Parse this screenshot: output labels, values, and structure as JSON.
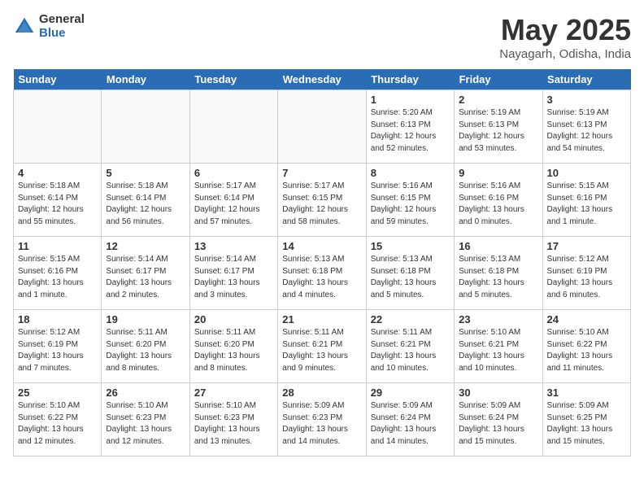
{
  "header": {
    "logo_general": "General",
    "logo_blue": "Blue",
    "month_title": "May 2025",
    "location": "Nayagarh, Odisha, India"
  },
  "days_of_week": [
    "Sunday",
    "Monday",
    "Tuesday",
    "Wednesday",
    "Thursday",
    "Friday",
    "Saturday"
  ],
  "weeks": [
    [
      {
        "day": "",
        "info": ""
      },
      {
        "day": "",
        "info": ""
      },
      {
        "day": "",
        "info": ""
      },
      {
        "day": "",
        "info": ""
      },
      {
        "day": "1",
        "info": "Sunrise: 5:20 AM\nSunset: 6:13 PM\nDaylight: 12 hours\nand 52 minutes."
      },
      {
        "day": "2",
        "info": "Sunrise: 5:19 AM\nSunset: 6:13 PM\nDaylight: 12 hours\nand 53 minutes."
      },
      {
        "day": "3",
        "info": "Sunrise: 5:19 AM\nSunset: 6:13 PM\nDaylight: 12 hours\nand 54 minutes."
      }
    ],
    [
      {
        "day": "4",
        "info": "Sunrise: 5:18 AM\nSunset: 6:14 PM\nDaylight: 12 hours\nand 55 minutes."
      },
      {
        "day": "5",
        "info": "Sunrise: 5:18 AM\nSunset: 6:14 PM\nDaylight: 12 hours\nand 56 minutes."
      },
      {
        "day": "6",
        "info": "Sunrise: 5:17 AM\nSunset: 6:14 PM\nDaylight: 12 hours\nand 57 minutes."
      },
      {
        "day": "7",
        "info": "Sunrise: 5:17 AM\nSunset: 6:15 PM\nDaylight: 12 hours\nand 58 minutes."
      },
      {
        "day": "8",
        "info": "Sunrise: 5:16 AM\nSunset: 6:15 PM\nDaylight: 12 hours\nand 59 minutes."
      },
      {
        "day": "9",
        "info": "Sunrise: 5:16 AM\nSunset: 6:16 PM\nDaylight: 13 hours\nand 0 minutes."
      },
      {
        "day": "10",
        "info": "Sunrise: 5:15 AM\nSunset: 6:16 PM\nDaylight: 13 hours\nand 1 minute."
      }
    ],
    [
      {
        "day": "11",
        "info": "Sunrise: 5:15 AM\nSunset: 6:16 PM\nDaylight: 13 hours\nand 1 minute."
      },
      {
        "day": "12",
        "info": "Sunrise: 5:14 AM\nSunset: 6:17 PM\nDaylight: 13 hours\nand 2 minutes."
      },
      {
        "day": "13",
        "info": "Sunrise: 5:14 AM\nSunset: 6:17 PM\nDaylight: 13 hours\nand 3 minutes."
      },
      {
        "day": "14",
        "info": "Sunrise: 5:13 AM\nSunset: 6:18 PM\nDaylight: 13 hours\nand 4 minutes."
      },
      {
        "day": "15",
        "info": "Sunrise: 5:13 AM\nSunset: 6:18 PM\nDaylight: 13 hours\nand 5 minutes."
      },
      {
        "day": "16",
        "info": "Sunrise: 5:13 AM\nSunset: 6:18 PM\nDaylight: 13 hours\nand 5 minutes."
      },
      {
        "day": "17",
        "info": "Sunrise: 5:12 AM\nSunset: 6:19 PM\nDaylight: 13 hours\nand 6 minutes."
      }
    ],
    [
      {
        "day": "18",
        "info": "Sunrise: 5:12 AM\nSunset: 6:19 PM\nDaylight: 13 hours\nand 7 minutes."
      },
      {
        "day": "19",
        "info": "Sunrise: 5:11 AM\nSunset: 6:20 PM\nDaylight: 13 hours\nand 8 minutes."
      },
      {
        "day": "20",
        "info": "Sunrise: 5:11 AM\nSunset: 6:20 PM\nDaylight: 13 hours\nand 8 minutes."
      },
      {
        "day": "21",
        "info": "Sunrise: 5:11 AM\nSunset: 6:21 PM\nDaylight: 13 hours\nand 9 minutes."
      },
      {
        "day": "22",
        "info": "Sunrise: 5:11 AM\nSunset: 6:21 PM\nDaylight: 13 hours\nand 10 minutes."
      },
      {
        "day": "23",
        "info": "Sunrise: 5:10 AM\nSunset: 6:21 PM\nDaylight: 13 hours\nand 10 minutes."
      },
      {
        "day": "24",
        "info": "Sunrise: 5:10 AM\nSunset: 6:22 PM\nDaylight: 13 hours\nand 11 minutes."
      }
    ],
    [
      {
        "day": "25",
        "info": "Sunrise: 5:10 AM\nSunset: 6:22 PM\nDaylight: 13 hours\nand 12 minutes."
      },
      {
        "day": "26",
        "info": "Sunrise: 5:10 AM\nSunset: 6:23 PM\nDaylight: 13 hours\nand 12 minutes."
      },
      {
        "day": "27",
        "info": "Sunrise: 5:10 AM\nSunset: 6:23 PM\nDaylight: 13 hours\nand 13 minutes."
      },
      {
        "day": "28",
        "info": "Sunrise: 5:09 AM\nSunset: 6:23 PM\nDaylight: 13 hours\nand 14 minutes."
      },
      {
        "day": "29",
        "info": "Sunrise: 5:09 AM\nSunset: 6:24 PM\nDaylight: 13 hours\nand 14 minutes."
      },
      {
        "day": "30",
        "info": "Sunrise: 5:09 AM\nSunset: 6:24 PM\nDaylight: 13 hours\nand 15 minutes."
      },
      {
        "day": "31",
        "info": "Sunrise: 5:09 AM\nSunset: 6:25 PM\nDaylight: 13 hours\nand 15 minutes."
      }
    ]
  ]
}
